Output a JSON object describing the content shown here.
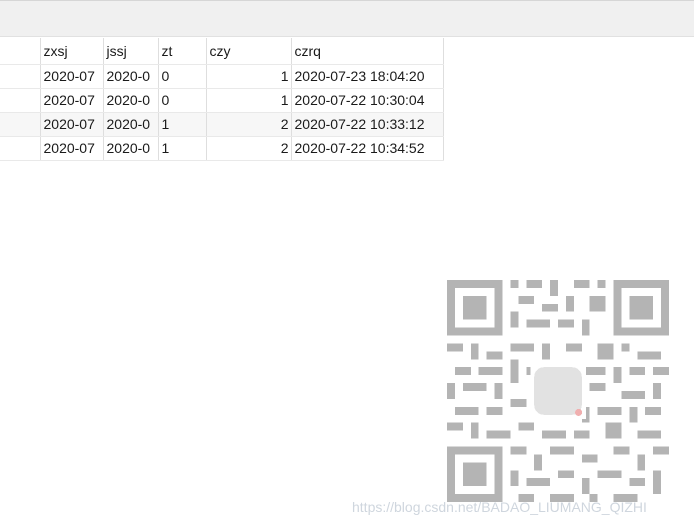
{
  "table": {
    "columns": [
      "",
      "zxsj",
      "jssj",
      "zt",
      "czy",
      "czrq"
    ],
    "rows": [
      {
        "zxsj": "2020-07",
        "jssj": "2020-0",
        "zt": "0",
        "czy": "1",
        "czrq": "2020-07-23 18:04:20"
      },
      {
        "zxsj": "2020-07",
        "jssj": "2020-0",
        "zt": "0",
        "czy": "1",
        "czrq": "2020-07-22 10:30:04"
      },
      {
        "zxsj": "2020-07",
        "jssj": "2020-0",
        "zt": "1",
        "czy": "2",
        "czrq": "2020-07-22 10:33:12"
      },
      {
        "zxsj": "2020-07",
        "jssj": "2020-0",
        "zt": "1",
        "czy": "2",
        "czrq": "2020-07-22 10:34:52"
      }
    ]
  },
  "watermark": {
    "text": "https://blog.csdn.net/BADAO_LIUMANG_QIZHI",
    "icon": "qr-code-icon"
  },
  "colors": {
    "toolbar_bg": "#f0f0f0",
    "grid_line": "#dedede",
    "alt_row": "#f7f7f7",
    "watermark_text": "#cfd6de"
  }
}
